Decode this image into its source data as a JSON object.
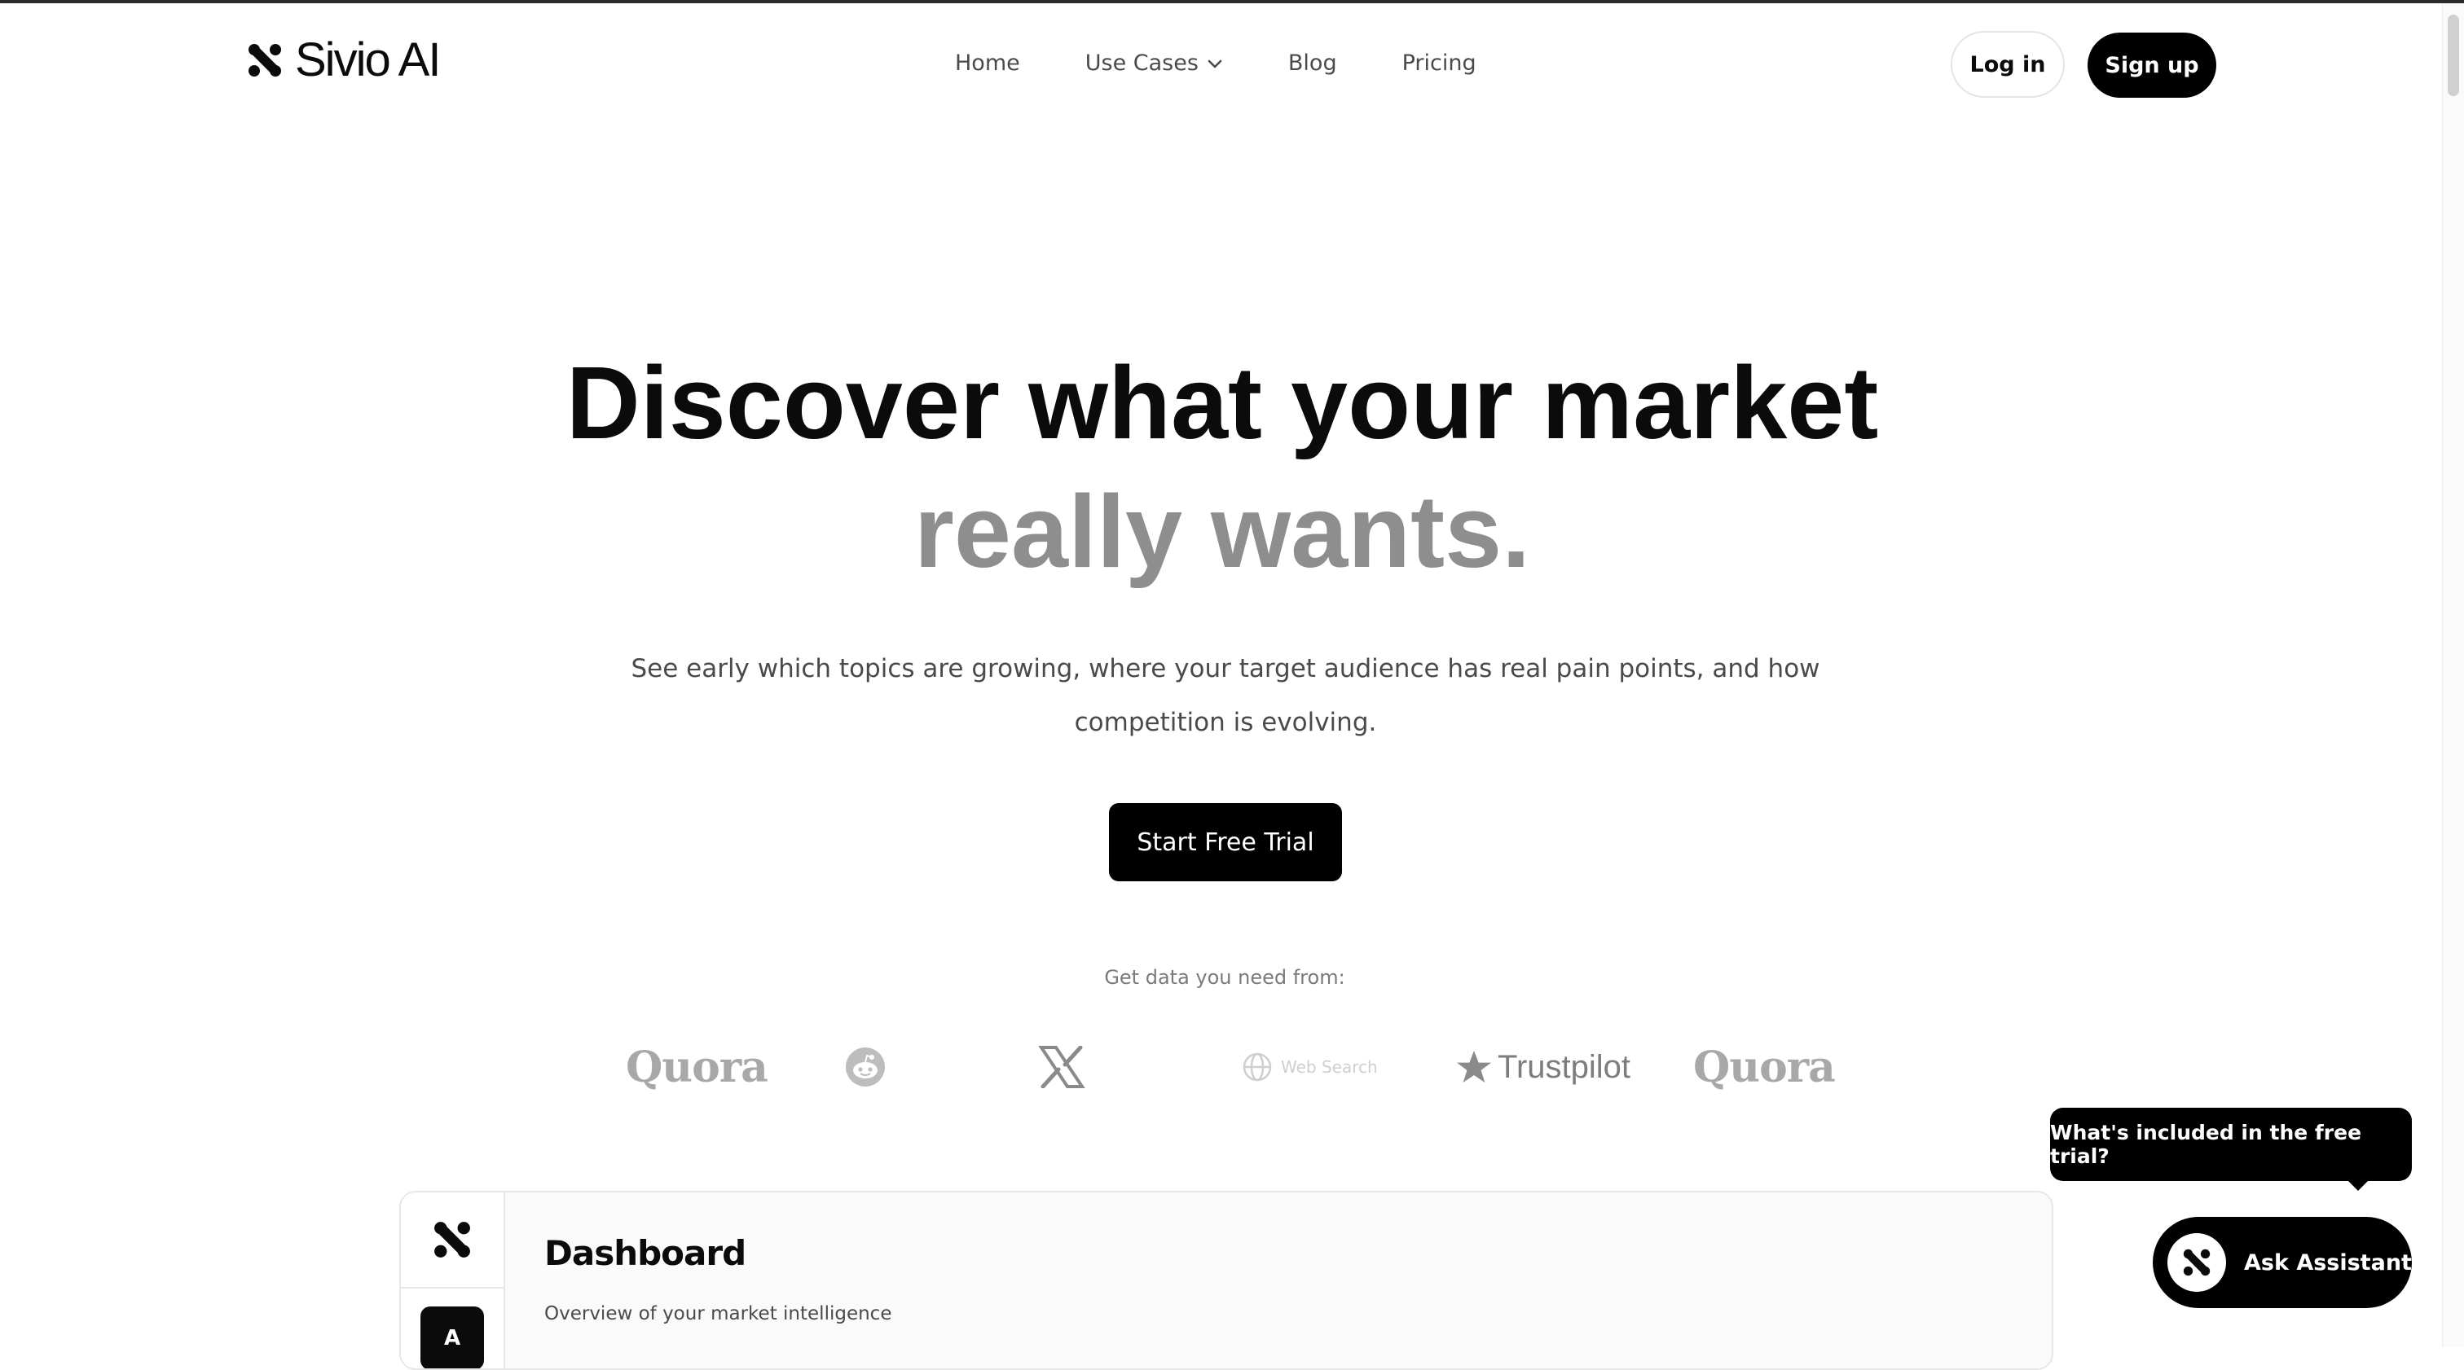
{
  "brand": {
    "name": "Sivio AI"
  },
  "nav": {
    "items": [
      {
        "label": "Home"
      },
      {
        "label": "Use Cases"
      },
      {
        "label": "Blog"
      },
      {
        "label": "Pricing"
      }
    ]
  },
  "auth": {
    "login_label": "Log in",
    "signup_label": "Sign up"
  },
  "hero": {
    "headline_line1": "Discover what your market",
    "headline_line2": "really wants.",
    "subtext": "See early which topics are growing, where your target audience has real pain points, and how competition is evolving.",
    "cta_label": "Start Free Trial"
  },
  "sources": {
    "label": "Get data you need from:",
    "items": [
      {
        "name": "Quora",
        "icon": "quora-wordmark"
      },
      {
        "name": "",
        "icon": "reddit-icon"
      },
      {
        "name": "",
        "icon": "x-icon"
      },
      {
        "name": "Web Search",
        "icon": "globe-icon"
      },
      {
        "name": "Trustpilot",
        "icon": "star-icon"
      },
      {
        "name": "Quora",
        "icon": "quora-wordmark"
      }
    ]
  },
  "dashboard_preview": {
    "avatar_initial": "A",
    "title": "Dashboard",
    "subtitle": "Overview of your market intelligence"
  },
  "assistant": {
    "tooltip": "What's included in the free trial?",
    "button_label": "Ask Assistant"
  },
  "colors": {
    "primary": "#000000",
    "headline_muted": "#8e8e8e",
    "body_text": "#4a4a4a",
    "background": "#ffffff"
  }
}
